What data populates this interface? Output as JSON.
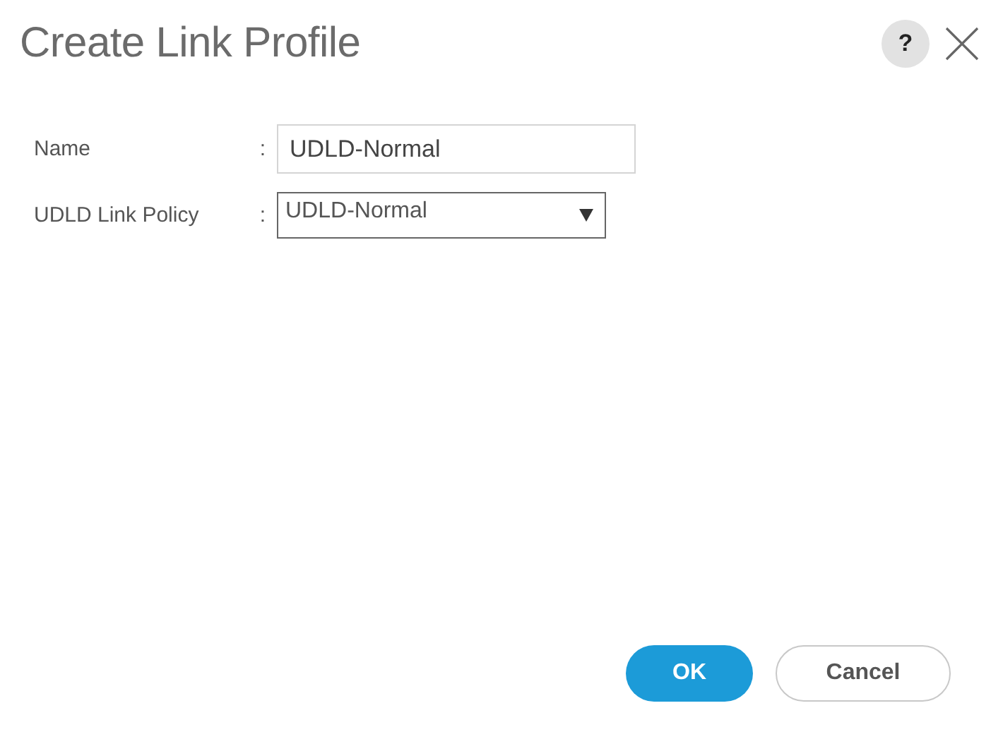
{
  "dialog": {
    "title": "Create Link Profile",
    "help": "?"
  },
  "fields": [
    {
      "kind": "text",
      "label": "Name",
      "separator": ":",
      "value": "UDLD-Normal"
    },
    {
      "kind": "select",
      "label": "UDLD Link Policy",
      "separator": ":",
      "value": "UDLD-Normal"
    }
  ],
  "buttons": [
    {
      "label": "OK",
      "primary": true
    },
    {
      "label": "Cancel",
      "primary": false
    }
  ]
}
